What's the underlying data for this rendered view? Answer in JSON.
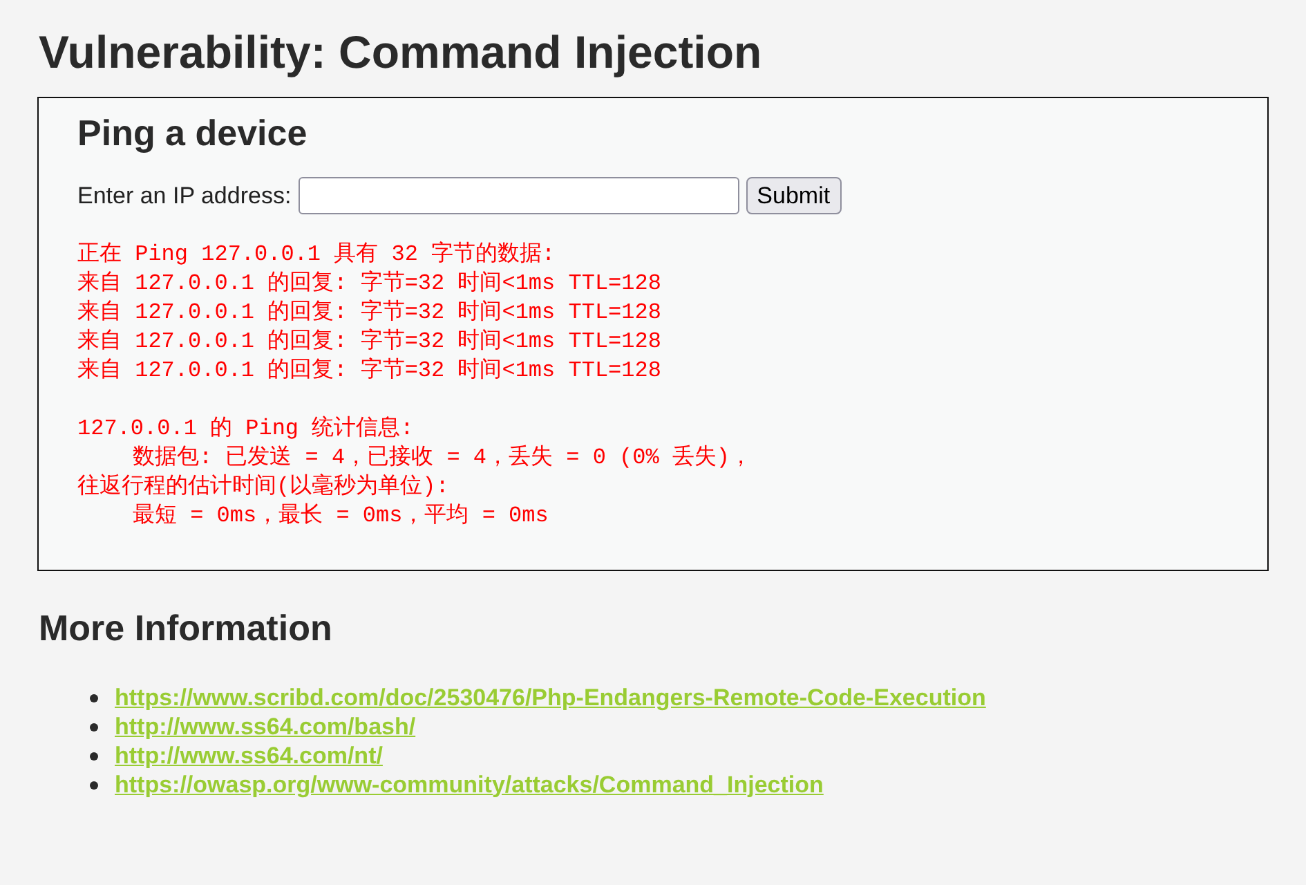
{
  "page_title": "Vulnerability: Command Injection",
  "panel": {
    "title": "Ping a device",
    "form": {
      "label": "Enter an IP address:",
      "button": "Submit"
    },
    "output": [
      {
        "lines": [
          {
            "text": "正在 Ping 127.0.0.1 具有 32 字节的数据:"
          },
          {
            "text": "来自 127.0.0.1 的回复: 字节=32 时间<1ms TTL=128"
          },
          {
            "text": "来自 127.0.0.1 的回复: 字节=32 时间<1ms TTL=128"
          },
          {
            "text": "来自 127.0.0.1 的回复: 字节=32 时间<1ms TTL=128"
          },
          {
            "text": "来自 127.0.0.1 的回复: 字节=32 时间<1ms TTL=128"
          }
        ]
      },
      {
        "lines": [
          {
            "text": "127.0.0.1 的 Ping 统计信息:",
            "children": [
              {
                "text": "数据包: 已发送 = 4，已接收 = 4，丢失 = 0 (0% 丢失)，"
              }
            ]
          },
          {
            "text": "往返行程的估计时间(以毫秒为单位):",
            "children": [
              {
                "text": "最短 = 0ms，最长 = 0ms，平均 = 0ms"
              }
            ]
          }
        ]
      }
    ]
  },
  "more_info": {
    "title": "More Information",
    "links": [
      "https://www.scribd.com/doc/2530476/Php-Endangers-Remote-Code-Execution",
      "http://www.ss64.com/bash/",
      "http://www.ss64.com/nt/",
      "https://owasp.org/www-community/attacks/Command_Injection"
    ]
  }
}
